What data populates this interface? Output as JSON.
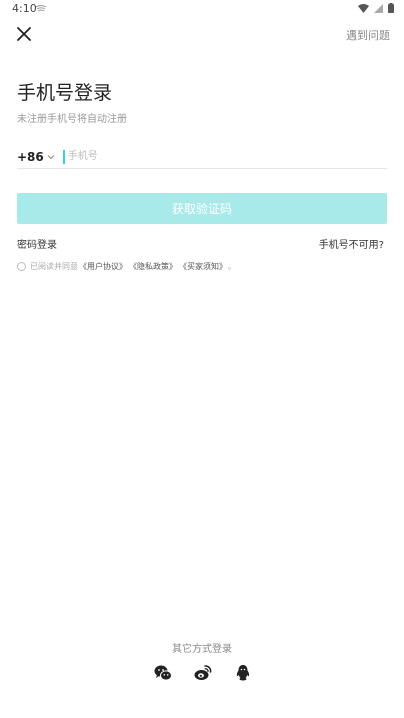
{
  "status_bar": {
    "time": "4:10"
  },
  "header": {
    "help_label": "遇到问题"
  },
  "login": {
    "title": "手机号登录",
    "subtitle": "未注册手机号将自动注册",
    "country_code": "+86",
    "phone_placeholder": "手机号",
    "phone_value": "",
    "get_code_button": "获取验证码",
    "password_login": "密码登录",
    "phone_unavailable": "手机号不可用?"
  },
  "agreement": {
    "prefix": "已阅读并同意",
    "links": [
      "《用户协议》",
      "《隐私政策》",
      "《买家须知》"
    ],
    "suffix": "。"
  },
  "other_login": {
    "label": "其它方式登录",
    "methods": [
      "wechat-icon",
      "weibo-icon",
      "qq-icon"
    ]
  },
  "colors": {
    "accent": "#39d1d1",
    "button_disabled": "#a8eaea"
  }
}
